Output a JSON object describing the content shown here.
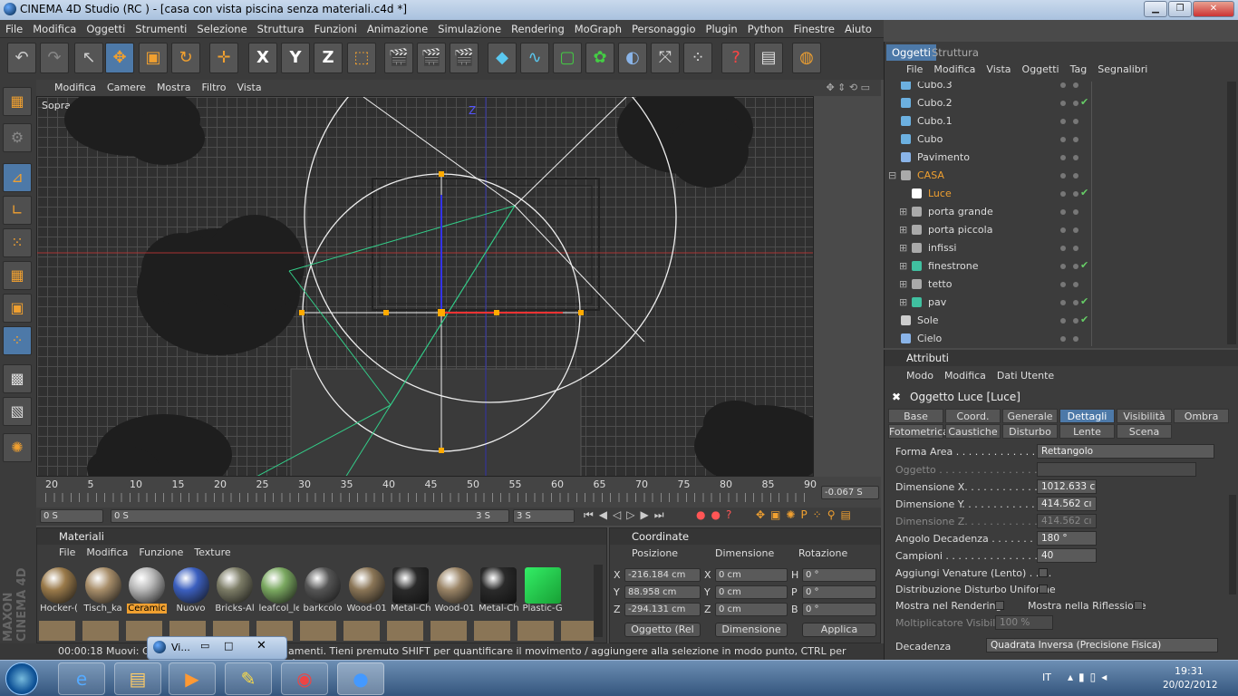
{
  "window": {
    "title": "CINEMA 4D Studio (RC ) - [casa con vista piscina senza materiali.c4d *]",
    "min": "▁",
    "max": "❐",
    "close": "✕"
  },
  "menu": [
    "File",
    "Modifica",
    "Oggetti",
    "Strumenti",
    "Selezione",
    "Struttura",
    "Funzioni",
    "Animazione",
    "Simulazione",
    "Rendering",
    "MoGraph",
    "Personaggio",
    "Plugin",
    "Python",
    "Finestre",
    "Aiuto"
  ],
  "toolbar": [
    "undo-icon",
    "redo-icon",
    "select-cursor-icon",
    "move-icon",
    "scale-icon",
    "rotate-icon",
    "live-select-icon",
    "x-axis-icon",
    "y-axis-icon",
    "z-axis-icon",
    "coordinate-system-icon",
    "render-view-icon",
    "render-picture-icon",
    "render-settings-icon",
    "cube-icon",
    "spline-icon",
    "nurbs-icon",
    "array-icon",
    "deformer-icon",
    "scene-icon",
    "particle-icon",
    "help-icon",
    "content-browser-icon",
    "web-icon"
  ],
  "toolbar_glyphs": {
    "xaxis": "X",
    "yaxis": "Y",
    "zaxis": "Z",
    "help": "?"
  },
  "viewport": {
    "menu": [
      "Modifica",
      "Camere",
      "Mostra",
      "Filtro",
      "Vista"
    ],
    "label": "Sopra",
    "axis_z": "Z"
  },
  "timeline": {
    "ticks": [
      "20",
      "5",
      "10",
      "15",
      "20",
      "25",
      "30",
      "35",
      "40",
      "45",
      "50",
      "55",
      "60",
      "65",
      "70",
      "75",
      "80",
      "85",
      "90"
    ],
    "current": "-0.067 S",
    "start": "0 S",
    "range_start": "0 S",
    "range_end": "3 S",
    "end": "3 S"
  },
  "materials": {
    "title": "Materiali",
    "menu": [
      "File",
      "Modifica",
      "Funzione",
      "Texture"
    ],
    "items": [
      {
        "label": "Hocker-(",
        "color": "#9a7a4a"
      },
      {
        "label": "Tisch_ka",
        "color": "#a88e6a"
      },
      {
        "label": "Ceramic",
        "color": "#b8b8b8",
        "selected": true
      },
      {
        "label": "Nuovo",
        "color": "#3b5fbf"
      },
      {
        "label": "Bricks-Al",
        "color": "#7c7c66"
      },
      {
        "label": "leafcol_le",
        "color": "#7aa860"
      },
      {
        "label": "barkcolo",
        "color": "#555"
      },
      {
        "label": "Wood-01",
        "color": "#8a7556"
      },
      {
        "label": "Metal-Ch",
        "color": "#2a2a2a"
      },
      {
        "label": "Wood-01",
        "color": "#9a8466"
      },
      {
        "label": "Metal-Ch",
        "color": "#2a2a2a"
      },
      {
        "label": "Plastic-G",
        "color": "#18a035"
      }
    ]
  },
  "coords": {
    "title": "Coordinate",
    "headers": [
      "Posizione",
      "Dimensione",
      "Rotazione"
    ],
    "rows": [
      {
        "axis": "X",
        "pos": "-216.184 cm",
        "dimaxis": "X",
        "dim": "0 cm",
        "rotaxis": "H",
        "rot": "0 °"
      },
      {
        "axis": "Y",
        "pos": "88.958 cm",
        "dimaxis": "Y",
        "dim": "0 cm",
        "rotaxis": "P",
        "rot": "0 °"
      },
      {
        "axis": "Z",
        "pos": "-294.131 cm",
        "dimaxis": "Z",
        "dim": "0 cm",
        "rotaxis": "B",
        "rot": "0 °"
      }
    ],
    "mode1": "Oggetto (Rel",
    "mode2": "Dimensione",
    "apply": "Applica"
  },
  "status": {
    "time": "00:00:18",
    "text": "Muovi: Cl",
    "text2": "amenti. Tieni premuto SHIFT per quantificare il movimento / aggiungere alla selezione in modo punto, CTRL per rimuovere."
  },
  "brand": "MAXON CINEMA 4D",
  "objects": {
    "tabs": [
      "Oggetti",
      "Struttura"
    ],
    "menu": [
      "File",
      "Modifica",
      "Vista",
      "Oggetti",
      "Tag",
      "Segnalibri"
    ],
    "items": [
      {
        "name": "Cubo.3",
        "indent": 0,
        "color": "#6cb0e0"
      },
      {
        "name": "Cubo.2",
        "indent": 0,
        "color": "#6cb0e0",
        "check": "✔"
      },
      {
        "name": "Cubo.1",
        "indent": 0,
        "color": "#6cb0e0"
      },
      {
        "name": "Cubo",
        "indent": 0,
        "color": "#6cb0e0"
      },
      {
        "name": "Pavimento",
        "indent": 0,
        "color": "#8ab4e8"
      },
      {
        "name": "CASA",
        "indent": 0,
        "color": "#aaa",
        "orange": true
      },
      {
        "name": "Luce",
        "indent": 1,
        "color": "#fff",
        "orange": true,
        "check": "✔"
      },
      {
        "name": "porta grande",
        "indent": 1,
        "color": "#aaa"
      },
      {
        "name": "porta piccola",
        "indent": 1,
        "color": "#aaa"
      },
      {
        "name": "infissi",
        "indent": 1,
        "color": "#aaa"
      },
      {
        "name": "finestrone",
        "indent": 1,
        "color": "#40c0a0",
        "check": "✔"
      },
      {
        "name": "tetto",
        "indent": 1,
        "color": "#aaa"
      },
      {
        "name": "pav",
        "indent": 1,
        "color": "#40c0a0",
        "check": "✔"
      },
      {
        "name": "Sole",
        "indent": 0,
        "color": "#ccc",
        "check": "✔"
      },
      {
        "name": "Cielo",
        "indent": 0,
        "color": "#8ab4e8"
      }
    ]
  },
  "attributes": {
    "title": "Attributi",
    "menu": [
      "Modo",
      "Modifica",
      "Dati Utente"
    ],
    "object": "Oggetto Luce [Luce]",
    "tabs1": [
      "Base",
      "Coord.",
      "Generale",
      "Dettagli",
      "Visibilità",
      "Ombra"
    ],
    "tabs2": [
      "Fotometrica",
      "Caustiche",
      "Disturbo",
      "Lente",
      "Scena"
    ],
    "active_tab": "Dettagli",
    "fields": {
      "forma_label": "Forma Area . . . . . . . . . . . . . . . .",
      "forma": "Rettangolo",
      "oggetto_label": "Oggetto . . . . . . . . . . . . . . . . . . . .",
      "dimx_label": "Dimensione X. . . . . . . . . . . . . . .",
      "dimx": "1012.633 c",
      "dimy_label": "Dimensione Y. . . . . . . . . . . . . . .",
      "dimy": "414.562 cı",
      "dimz_label": "Dimensione Z. . . . . . . . . . . . . . .",
      "dimz": "414.562 cı",
      "angolo_label": "Angolo Decadenza . . . . . . . . . .",
      "angolo": "180 °",
      "campioni_label": "Campioni . . . . . . . . . . . . . . . . . .",
      "campioni": "40",
      "venature": "Aggiungi Venature (Lento) . . . .",
      "distribuzione": "Distribuzione Disturbo Uniforme",
      "mostra_render": "Mostra nel Rendering",
      "mostra_rifl": "Mostra nella Riflessione",
      "molt_label": "Moltiplicatore Visibilità",
      "molt": "100 %",
      "decad_label": "Decadenza",
      "decad": "Quadrata Inversa (Precisione Fisica)"
    }
  },
  "taskbar": {
    "lang": "IT",
    "time": "19:31",
    "date": "20/02/2012",
    "flyout": "Vi..."
  }
}
